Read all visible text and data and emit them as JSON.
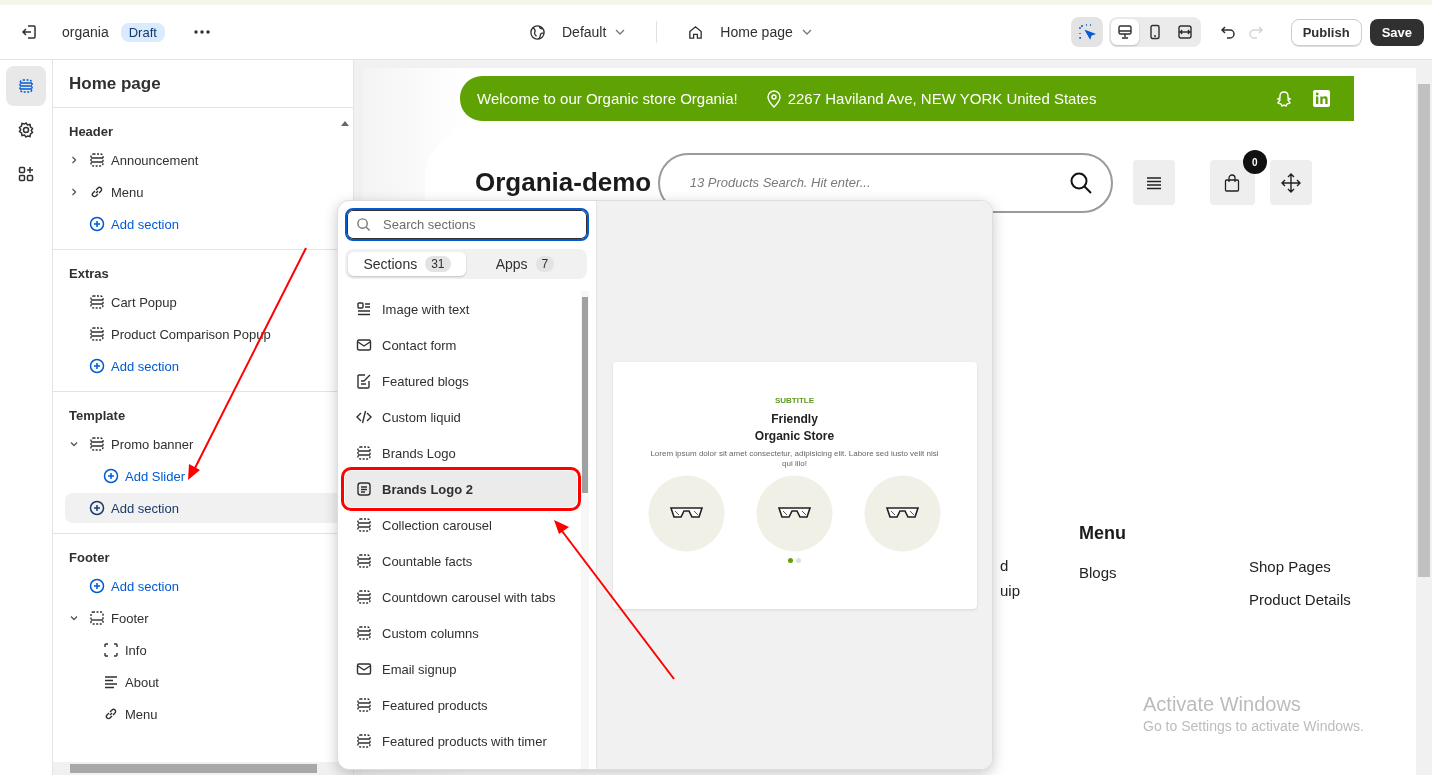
{
  "topbar": {
    "store_name": "organia",
    "status_badge": "Draft",
    "theme_selector": "Default",
    "page_selector": "Home page",
    "inspector_on": true,
    "device_modes": [
      {
        "kind": "desktop",
        "selected": true
      },
      {
        "kind": "mobile",
        "selected": false
      },
      {
        "kind": "fullwidth",
        "selected": false
      }
    ],
    "redo_disabled": true,
    "publish": "Publish",
    "save": "Save"
  },
  "rail": [
    {
      "kind": "sections",
      "selected": true
    },
    {
      "kind": "settings",
      "selected": false
    },
    {
      "kind": "apps",
      "selected": false
    }
  ],
  "sidebar": {
    "title": "Home page",
    "groups": [
      {
        "title": "Header",
        "items": [
          {
            "kind": "section",
            "label": "Announcement",
            "expanded": false
          },
          {
            "kind": "link",
            "label": "Menu",
            "expanded": false
          },
          {
            "kind": "add",
            "label": "Add section",
            "hovered": false
          }
        ]
      },
      {
        "title": "Extras",
        "items": [
          {
            "kind": "section",
            "label": "Cart Popup"
          },
          {
            "kind": "section",
            "label": "Product Comparison Popup"
          },
          {
            "kind": "add",
            "label": "Add section",
            "hovered": false
          }
        ]
      },
      {
        "title": "Template",
        "items": [
          {
            "kind": "section",
            "label": "Promo banner",
            "expanded": true,
            "children": [
              {
                "kind": "add",
                "label": "Add Slider",
                "hovered": false
              }
            ]
          },
          {
            "kind": "add",
            "label": "Add section",
            "hovered": true
          }
        ]
      },
      {
        "title": "Footer",
        "items": [
          {
            "kind": "add",
            "label": "Add section",
            "hovered": false
          },
          {
            "kind": "group",
            "label": "Footer",
            "expanded": true,
            "children": [
              {
                "kind": "block",
                "label": "Info"
              },
              {
                "kind": "text",
                "label": "About"
              },
              {
                "kind": "link",
                "label": "Menu"
              }
            ]
          }
        ]
      }
    ]
  },
  "store": {
    "welcome": "Welcome to our Organic store Organia!",
    "address": "2267 Haviland Ave, NEW YORK United States",
    "logo": "Organia-demo",
    "search_placeholder": "13 Products Search. Hit enter...",
    "cart_count": "0",
    "footer": {
      "column_1": [
        "d",
        "uip"
      ],
      "heading": "Menu",
      "column_2": [
        "Blogs"
      ],
      "column_3": [
        "Shop Pages",
        "Product Details"
      ]
    }
  },
  "popover": {
    "search_placeholder": "Search sections",
    "tabs": [
      {
        "label": "Sections",
        "count": "31",
        "selected": true
      },
      {
        "label": "Apps",
        "count": "7",
        "selected": false
      }
    ],
    "items": [
      {
        "kind": "image-text",
        "label": "Image with text",
        "selected": false,
        "annotated": false
      },
      {
        "kind": "mail",
        "label": "Contact form",
        "selected": false,
        "annotated": false
      },
      {
        "kind": "blog",
        "label": "Featured blogs",
        "selected": false,
        "annotated": false
      },
      {
        "kind": "code",
        "label": "Custom liquid",
        "selected": false,
        "annotated": false
      },
      {
        "kind": "section",
        "label": "Brands Logo",
        "selected": false,
        "annotated": false
      },
      {
        "kind": "list",
        "label": "Brands Logo 2",
        "selected": true,
        "annotated": true
      },
      {
        "kind": "section",
        "label": "Collection carousel",
        "selected": false,
        "annotated": false
      },
      {
        "kind": "section",
        "label": "Countable facts",
        "selected": false,
        "annotated": false
      },
      {
        "kind": "section",
        "label": "Countdown carousel with tabs",
        "selected": false,
        "annotated": false
      },
      {
        "kind": "section",
        "label": "Custom columns",
        "selected": false,
        "annotated": false
      },
      {
        "kind": "mail",
        "label": "Email signup",
        "selected": false,
        "annotated": false
      },
      {
        "kind": "section",
        "label": "Featured products",
        "selected": false,
        "annotated": false
      },
      {
        "kind": "section",
        "label": "Featured products with timer",
        "selected": false,
        "annotated": false
      }
    ],
    "preview": {
      "subtitle": "SUBTITLE",
      "title_lines": [
        "Friendly",
        "Organic Store"
      ],
      "text": "Lorem ipsum dolor sit amet consectetur, adipisicing elit. Labore sed iusto velit nisi qui illo!",
      "dots": [
        {
          "selected": true
        },
        {
          "selected": false
        }
      ]
    }
  },
  "windows_notice": {
    "title": "Activate Windows",
    "text": "Go to Settings to activate Windows."
  }
}
